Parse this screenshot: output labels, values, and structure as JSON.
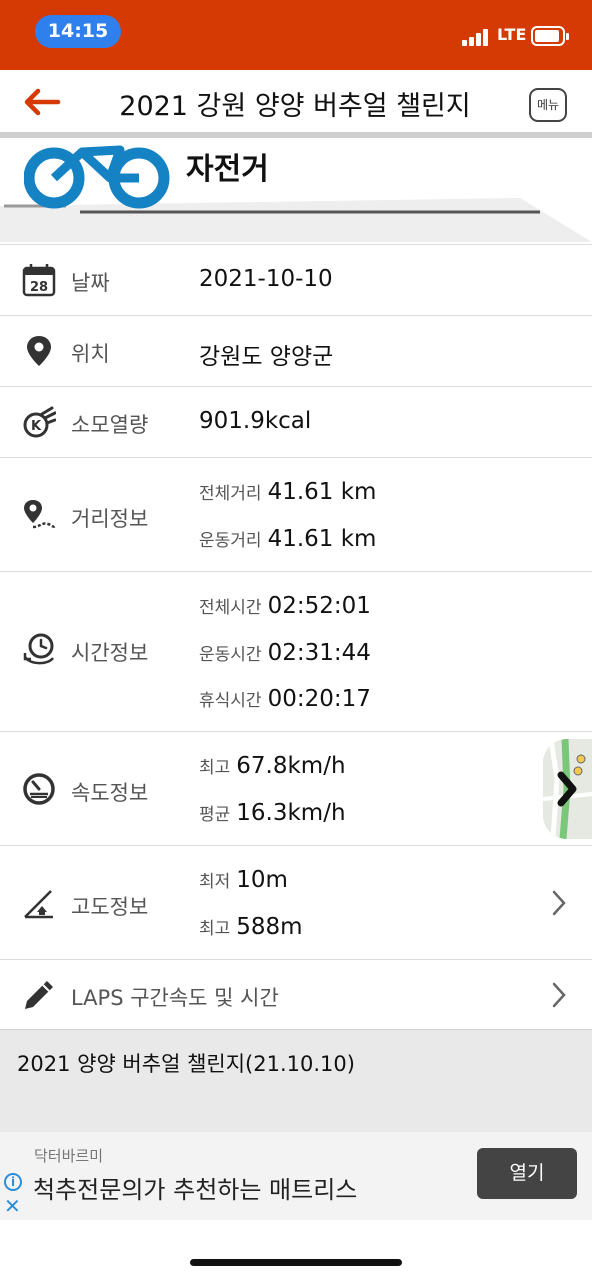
{
  "status_bar": {
    "time": "14:15",
    "network": "LTE"
  },
  "header": {
    "title": "2021 강원 양양 버추얼 챌린지",
    "back_icon": "back-arrow-icon",
    "menu_label": "메뉴"
  },
  "activity": {
    "type_label": "자전거",
    "icon": "bicycle-icon"
  },
  "rows": {
    "date": {
      "label": "날짜",
      "value": "2021-10-10",
      "icon": "calendar-icon",
      "icon_text": "28"
    },
    "location": {
      "label": "위치",
      "value": "강원도 양양군",
      "icon": "location-pin-icon"
    },
    "calories": {
      "label": "소모열량",
      "value": "901.9kcal",
      "icon": "calorie-flame-icon"
    },
    "distance": {
      "label": "거리정보",
      "icon": "route-distance-icon",
      "total_label": "전체거리",
      "total_value": "41.61 km",
      "moving_label": "운동거리",
      "moving_value": "41.61 km"
    },
    "time": {
      "label": "시간정보",
      "icon": "clock-icon",
      "total_label": "전체시간",
      "total_value": "02:52:01",
      "moving_label": "운동시간",
      "moving_value": "02:31:44",
      "rest_label": "휴식시간",
      "rest_value": "00:20:17"
    },
    "speed": {
      "label": "속도정보",
      "icon": "speedometer-icon",
      "max_label": "최고",
      "max_value": "67.8km/h",
      "avg_label": "평균",
      "avg_value": "16.3km/h"
    },
    "altitude": {
      "label": "고도정보",
      "icon": "altitude-icon",
      "min_label": "최저",
      "min_value": "10m",
      "max_label": "최고",
      "max_value": "588m"
    },
    "laps": {
      "label": "LAPS 구간속도 및 시간",
      "icon": "pencil-icon"
    }
  },
  "note": {
    "text": "2021 양양 버추얼 챌린지(21.10.10)"
  },
  "ad": {
    "brand": "닥터바르미",
    "text": "척추전문의가 추천하는 매트리스",
    "button_label": "열기",
    "info_glyph": "i",
    "close_glyph": "✕"
  },
  "colors": {
    "status_bar": "#d63a04",
    "accent": "#d63a04",
    "bike_blue": "#1582c4",
    "time_pill": "#2f80ed"
  }
}
